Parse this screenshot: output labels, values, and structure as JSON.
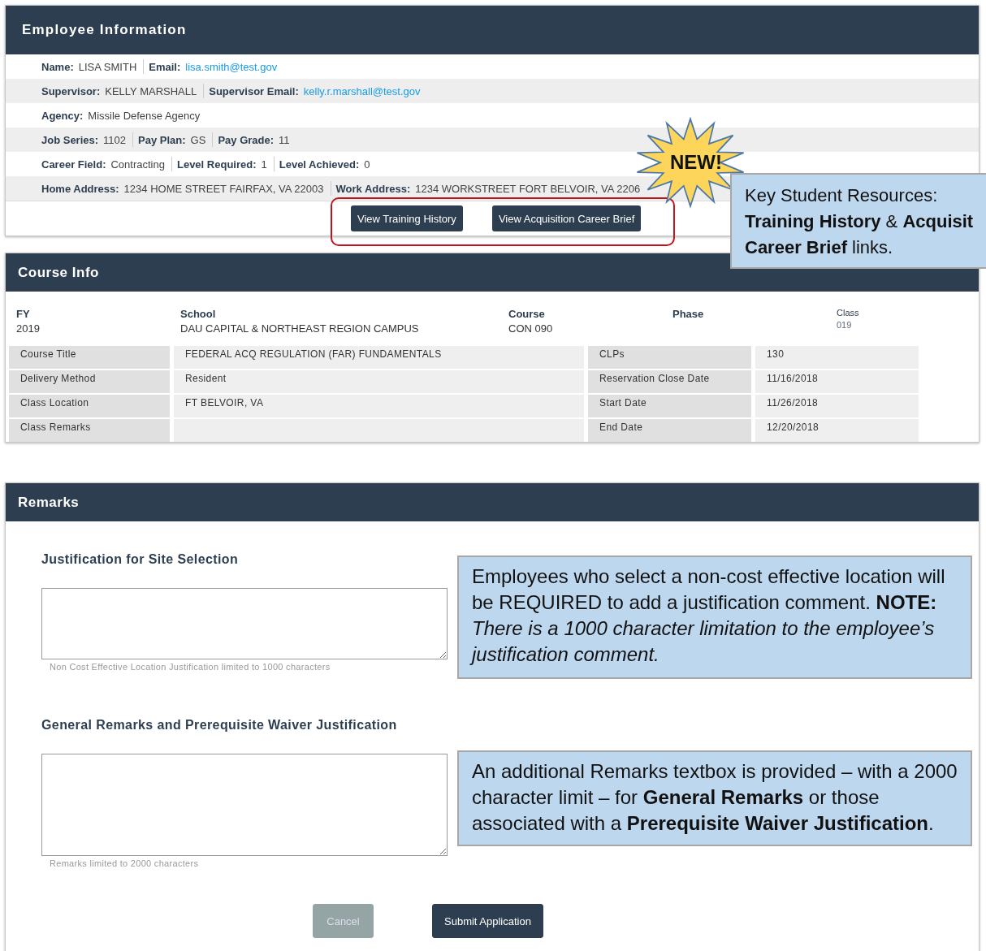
{
  "employee_panel": {
    "title": "Employee Information",
    "rows": [
      {
        "fields": [
          {
            "label": "Name:",
            "value": "LISA SMITH",
            "kind": "text"
          },
          {
            "label": "Email:",
            "value": "lisa.smith@test.gov",
            "kind": "link"
          }
        ]
      },
      {
        "fields": [
          {
            "label": "Supervisor:",
            "value": "KELLY MARSHALL",
            "kind": "text"
          },
          {
            "label": "Supervisor Email:",
            "value": "kelly.r.marshall@test.gov",
            "kind": "link"
          }
        ]
      },
      {
        "fields": [
          {
            "label": "Agency:",
            "value": "Missile Defense Agency",
            "kind": "text"
          }
        ]
      },
      {
        "fields": [
          {
            "label": "Job Series:",
            "value": "1102",
            "kind": "text"
          },
          {
            "label": "Pay Plan:",
            "value": "GS",
            "kind": "text"
          },
          {
            "label": "Pay Grade:",
            "value": "11",
            "kind": "text"
          }
        ]
      },
      {
        "fields": [
          {
            "label": "Career Field:",
            "value": "Contracting",
            "kind": "text"
          },
          {
            "label": "Level Required:",
            "value": "1",
            "kind": "text"
          },
          {
            "label": "Level Achieved:",
            "value": "0",
            "kind": "text"
          }
        ]
      },
      {
        "fields": [
          {
            "label": "Home Address:",
            "value": "1234 HOME STREET FAIRFAX, VA 22003",
            "kind": "text"
          },
          {
            "label": "Work Address:",
            "value": "1234 WORKSTREET FORT BELVOIR, VA 2206",
            "kind": "text"
          }
        ]
      }
    ],
    "buttons": [
      "View Training History",
      "View Acquisition Career Brief"
    ]
  },
  "course_panel": {
    "title": "Course Info",
    "summary": [
      {
        "label": "FY",
        "value": "2019",
        "kind": "main"
      },
      {
        "label": "School",
        "value": "DAU CAPITAL & NORTHEAST REGION CAMPUS",
        "kind": "main"
      },
      {
        "label": "Course",
        "value": "CON 090",
        "kind": "main"
      },
      {
        "label": "Phase",
        "kind": "main"
      },
      {
        "label": "Class",
        "value": "019",
        "kind": "minor"
      }
    ],
    "rows": [
      {
        "label": "Course Title",
        "value": "FEDERAL ACQ REGULATION (FAR) FUNDAMENTALS",
        "label_2": "CLPs",
        "value_2": "130"
      },
      {
        "label": "Delivery Method",
        "value": "Resident",
        "label_2": "Reservation Close Date",
        "value_2": "11/16/2018"
      },
      {
        "label": "Class Location",
        "value": "FT BELVOIR, VA",
        "label_2": "Start Date",
        "value_2": "11/26/2018"
      },
      {
        "label": "Class Remarks",
        "label_2": "End Date",
        "value_2": "12/20/2018"
      }
    ]
  },
  "remarks_panel": {
    "title": "Remarks",
    "sections": [
      {
        "heading": "Justification for Site Selection",
        "hint": "Non Cost Effective Location Justification limited to 1000 characters",
        "callout": "Employees who select a non-cost effective location will be REQUIRED to add a justification comment. **NOTE:** *There is a 1000 character limitation to the employee’s justification comment.*"
      },
      {
        "heading": "General Remarks and Prerequisite Waiver Justification",
        "hint": "Remarks limited to 2000 characters",
        "callout": "An additional Remarks textbox is provided – with a 2000 character limit – for **General Remarks** or those associated with a **Prerequisite Waiver Justification**."
      }
    ],
    "buttons": [
      {
        "label": "Cancel",
        "disabled": true
      },
      {
        "label": "Submit Application",
        "disabled": false
      }
    ]
  },
  "new_badge": "NEW!",
  "resources_callout": [
    "Key Student Resources:",
    "**Training History** & **Acquisit**",
    "**Career Brief** links."
  ]
}
